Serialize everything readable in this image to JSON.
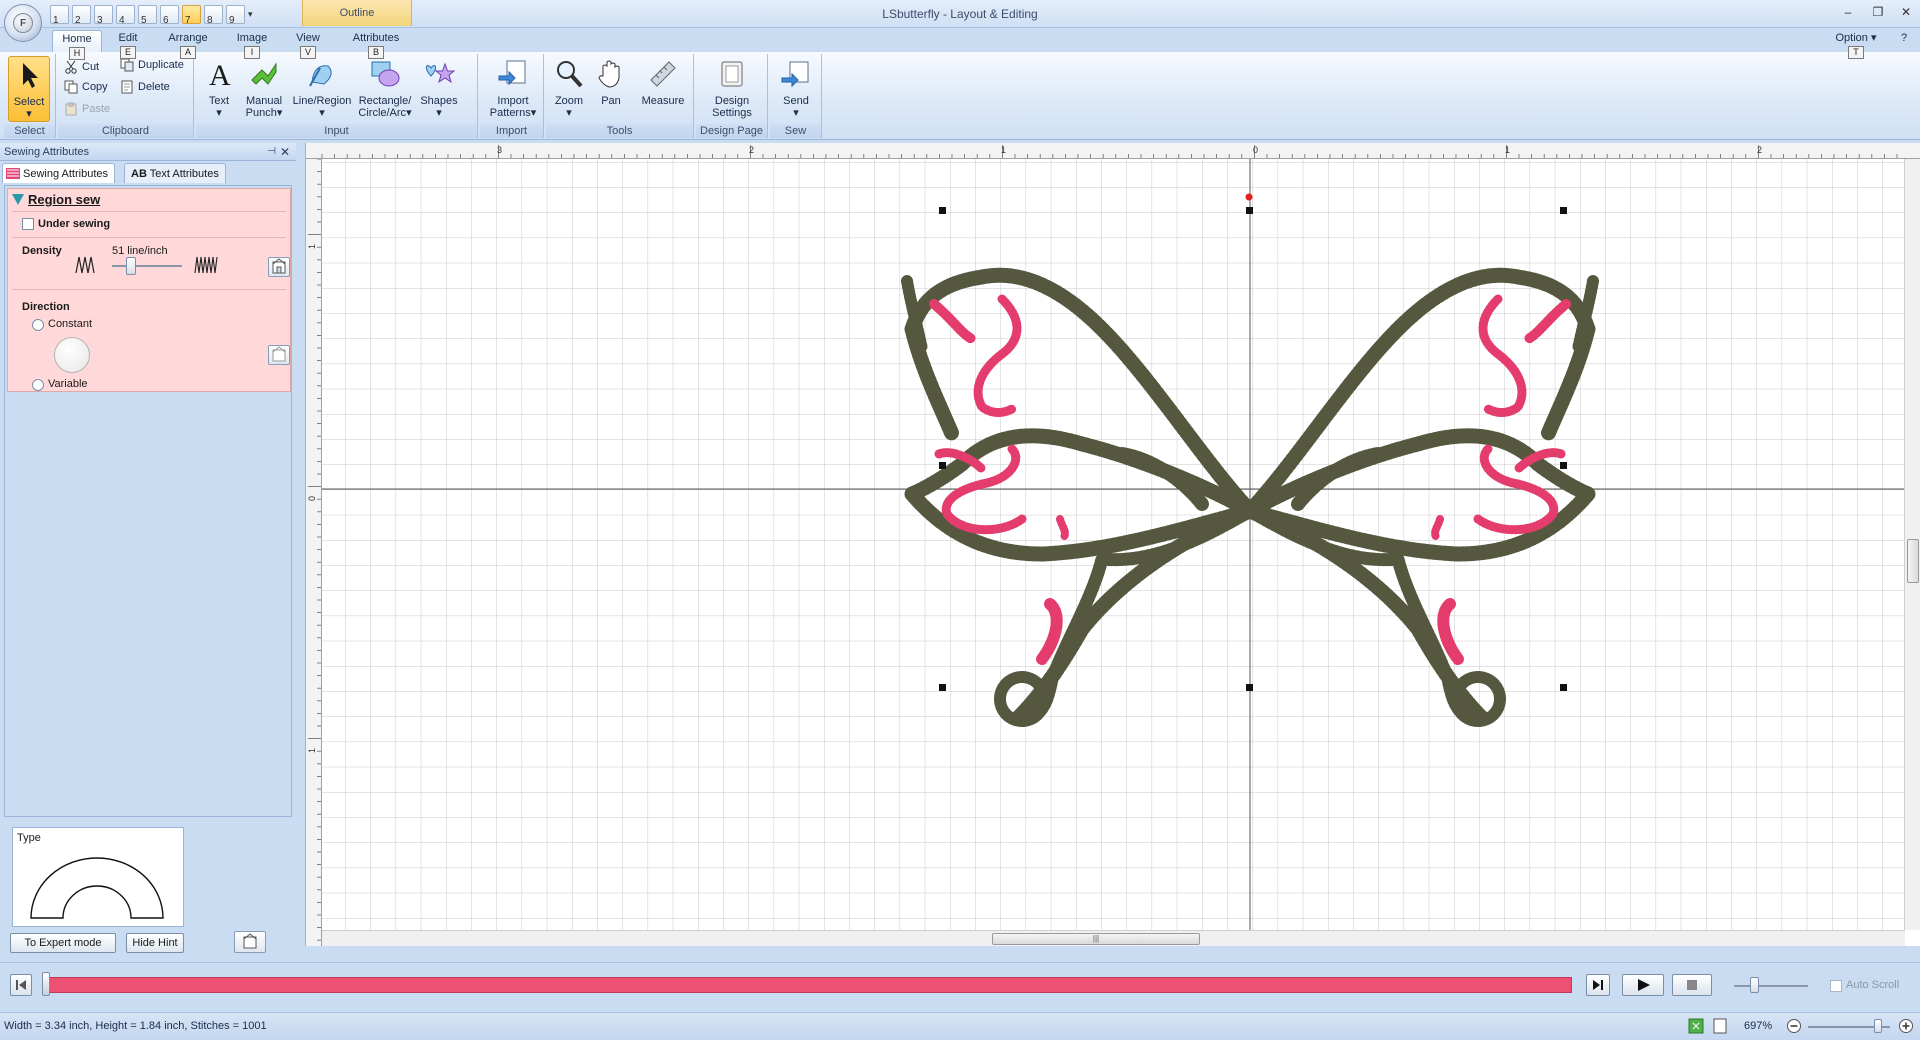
{
  "window": {
    "title": "LSbutterfly - Layout & Editing",
    "context_tab": "Outline",
    "app_button_label": "F",
    "option_label": "Option",
    "option_keytip": "T"
  },
  "quick_access": [
    "1",
    "2",
    "3",
    "4",
    "5",
    "6",
    "7",
    "8",
    "9"
  ],
  "tabs": [
    {
      "label": "Home",
      "keytip": "H",
      "active": true
    },
    {
      "label": "Edit",
      "keytip": "E"
    },
    {
      "label": "Arrange",
      "keytip": "A"
    },
    {
      "label": "Image",
      "keytip": "I"
    },
    {
      "label": "View",
      "keytip": "V"
    },
    {
      "label": "Attributes",
      "keytip": "B"
    }
  ],
  "ribbon": {
    "select": {
      "button": "Select",
      "group": "Select"
    },
    "clipboard": {
      "cut": "Cut",
      "copy": "Copy",
      "paste": "Paste",
      "duplicate": "Duplicate",
      "delete": "Delete",
      "group": "Clipboard"
    },
    "input": {
      "text": "Text",
      "manual_punch_1": "Manual",
      "manual_punch_2": "Punch",
      "line_region": "Line/Region",
      "rect_1": "Rectangle/",
      "rect_2": "Circle/Arc",
      "shapes": "Shapes",
      "group": "Input"
    },
    "import": {
      "label_1": "Import",
      "label_2": "Patterns",
      "group": "Import"
    },
    "tools": {
      "zoom": "Zoom",
      "pan": "Pan",
      "measure": "Measure",
      "group": "Tools"
    },
    "design_page": {
      "label_1": "Design",
      "label_2": "Settings",
      "group": "Design Page"
    },
    "sew": {
      "send": "Send",
      "group": "Sew"
    }
  },
  "panel": {
    "title": "Sewing Attributes",
    "tabs": [
      {
        "label": "Sewing Attributes",
        "active": true
      },
      {
        "label": "Text Attributes"
      }
    ],
    "text_tab_prefix": "AB",
    "region_title": "Region sew",
    "under_sewing": {
      "label": "Under sewing",
      "checked": false
    },
    "density": {
      "label": "Density",
      "value": "51 line/inch",
      "level": 0.3
    },
    "direction": {
      "label": "Direction",
      "options": [
        {
          "label": "Constant",
          "selected": false
        },
        {
          "label": "Variable",
          "selected": false
        }
      ]
    },
    "type_label": "Type",
    "expert_button": "To Expert mode",
    "hide_hint_button": "Hide Hint"
  },
  "ruler": {
    "top_labels": [
      "3",
      "2",
      "1",
      "0",
      "1",
      "2"
    ],
    "left_labels": [
      "1",
      "0",
      "1"
    ]
  },
  "colors": {
    "thread_olive": "#55573e",
    "thread_pink": "#e43c6c",
    "progress": "#ec5174",
    "accent": "#ffcf55"
  },
  "playback": {
    "progress": 1.0,
    "auto_scroll": "Auto Scroll",
    "auto_scroll_checked": false
  },
  "status": {
    "text": "Width = 3.34 inch, Height = 1.84 inch, Stitches = 1001",
    "zoom": "697%"
  }
}
